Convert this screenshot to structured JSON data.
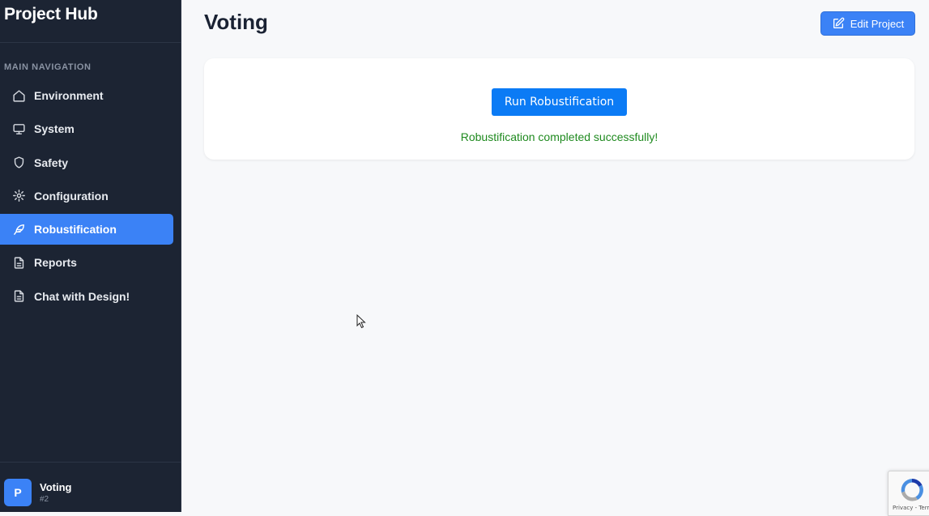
{
  "sidebar": {
    "brand": "Project Hub",
    "section_label": "MAIN NAVIGATION",
    "items": [
      {
        "label": "Environment",
        "icon": "home-icon",
        "active": false
      },
      {
        "label": "System",
        "icon": "monitor-icon",
        "active": false
      },
      {
        "label": "Safety",
        "icon": "shield-icon",
        "active": false
      },
      {
        "label": "Configuration",
        "icon": "gear-icon",
        "active": false
      },
      {
        "label": "Robustification",
        "icon": "feather-icon",
        "active": true
      },
      {
        "label": "Reports",
        "icon": "document-icon",
        "active": false
      },
      {
        "label": "Chat with Design!",
        "icon": "document-icon",
        "active": false
      }
    ],
    "project": {
      "avatar_letter": "P",
      "name": "Voting",
      "id": "#2"
    }
  },
  "header": {
    "title": "Voting",
    "edit_button_label": "Edit Project"
  },
  "main": {
    "run_button_label": "Run Robustification",
    "status_message": "Robustification completed successfully!"
  },
  "recaptcha": {
    "text": "Privacy - Terms"
  },
  "colors": {
    "sidebar_bg": "#1c2433",
    "accent": "#3b82f6",
    "run_button": "#0b7bf5",
    "success": "#1f8a1f",
    "page_bg": "#f7f8fa"
  }
}
